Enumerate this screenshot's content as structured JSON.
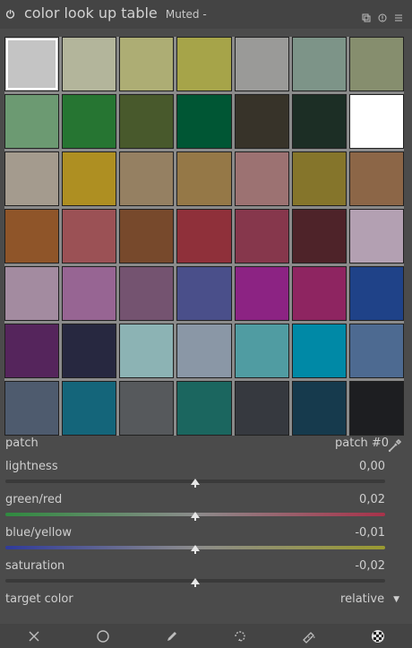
{
  "header": {
    "title": "color look up table",
    "preset": "Muted -",
    "icons": [
      "power-icon",
      "presets-icon",
      "reset-icon",
      "menu-icon"
    ]
  },
  "patches": [
    {
      "name": "patch-0",
      "color": "#c4c4c4",
      "selected": true
    },
    {
      "name": "patch-1",
      "color": "#b3b59b"
    },
    {
      "name": "patch-2",
      "color": "#adad74"
    },
    {
      "name": "patch-3",
      "color": "#a6a449"
    },
    {
      "name": "patch-4",
      "color": "#9a9a98"
    },
    {
      "name": "patch-5",
      "color": "#7d9488"
    },
    {
      "name": "patch-6",
      "color": "#868e6e"
    },
    {
      "name": "patch-7",
      "color": "#6c9a72"
    },
    {
      "name": "patch-8",
      "color": "#267532"
    },
    {
      "name": "patch-9",
      "color": "#48592c"
    },
    {
      "name": "patch-10",
      "color": "#005634"
    },
    {
      "name": "patch-11",
      "color": "#373329"
    },
    {
      "name": "patch-12",
      "color": "#1c2e25"
    },
    {
      "name": "patch-13",
      "color": "#ffffff"
    },
    {
      "name": "patch-14",
      "color": "#a49b8e"
    },
    {
      "name": "patch-15",
      "color": "#ae8f22"
    },
    {
      "name": "patch-16",
      "color": "#958062"
    },
    {
      "name": "patch-17",
      "color": "#957847"
    },
    {
      "name": "patch-18",
      "color": "#9c7272"
    },
    {
      "name": "patch-19",
      "color": "#85752b"
    },
    {
      "name": "patch-20",
      "color": "#8c6647"
    },
    {
      "name": "patch-21",
      "color": "#8f5529"
    },
    {
      "name": "patch-22",
      "color": "#9b5155"
    },
    {
      "name": "patch-23",
      "color": "#77492c"
    },
    {
      "name": "patch-24",
      "color": "#8f303a"
    },
    {
      "name": "patch-25",
      "color": "#86374c"
    },
    {
      "name": "patch-26",
      "color": "#4e2329"
    },
    {
      "name": "patch-27",
      "color": "#b3a0b2"
    },
    {
      "name": "patch-28",
      "color": "#a38ba0"
    },
    {
      "name": "patch-29",
      "color": "#976593"
    },
    {
      "name": "patch-30",
      "color": "#745370"
    },
    {
      "name": "patch-31",
      "color": "#4a4f8a"
    },
    {
      "name": "patch-32",
      "color": "#8c2383"
    },
    {
      "name": "patch-33",
      "color": "#8e2561"
    },
    {
      "name": "patch-34",
      "color": "#1f4288"
    },
    {
      "name": "patch-35",
      "color": "#55255c"
    },
    {
      "name": "patch-36",
      "color": "#272840"
    },
    {
      "name": "patch-37",
      "color": "#8cb3b4"
    },
    {
      "name": "patch-38",
      "color": "#8a97a6"
    },
    {
      "name": "patch-39",
      "color": "#509ca2"
    },
    {
      "name": "patch-40",
      "color": "#0089a6"
    },
    {
      "name": "patch-41",
      "color": "#4d6a91"
    },
    {
      "name": "patch-42",
      "color": "#4e5b6e"
    },
    {
      "name": "patch-43",
      "color": "#14657a"
    },
    {
      "name": "patch-44",
      "color": "#56595c"
    },
    {
      "name": "patch-45",
      "color": "#1b665f"
    },
    {
      "name": "patch-46",
      "color": "#36393f"
    },
    {
      "name": "patch-47",
      "color": "#163a4d"
    },
    {
      "name": "patch-48",
      "color": "#1d1e21"
    }
  ],
  "patch_row": {
    "label": "patch",
    "value": "patch #0"
  },
  "sliders": {
    "lightness": {
      "label": "lightness",
      "value": "0,00",
      "level": 0.5
    },
    "green_red": {
      "label": "green/red",
      "value": "0,02",
      "level": 0.5,
      "color_left": "#2f8a3f",
      "color_right": "#a8324a"
    },
    "blue_yellow": {
      "label": "blue/yellow",
      "value": "-0,01",
      "level": 0.5,
      "color_left": "#2f3a9a",
      "color_right": "#9a9a30"
    },
    "saturation": {
      "label": "saturation",
      "value": "-0,02",
      "level": 0.5
    }
  },
  "target": {
    "label": "target color",
    "value": "relative"
  },
  "footer_tools": [
    "clear-icon",
    "circle-icon",
    "pencil-icon",
    "rotate-icon",
    "gradient-icon",
    "checker-icon"
  ]
}
